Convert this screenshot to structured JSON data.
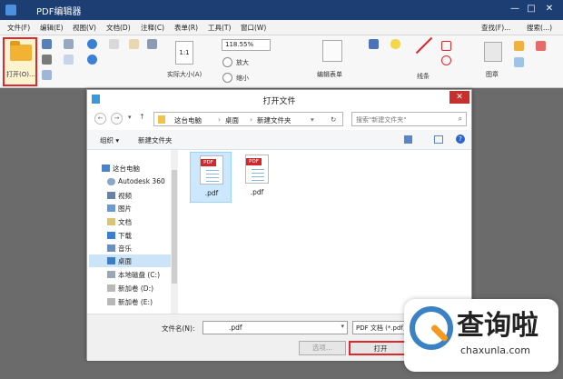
{
  "app": {
    "title": "PDF编辑器",
    "window_controls": [
      "—",
      "□",
      "✕"
    ]
  },
  "menu": [
    "文件(F)",
    "编辑(E)",
    "视图(V)",
    "文档(D)",
    "注释(C)",
    "表单(R)",
    "工具(T)",
    "窗口(W)"
  ],
  "menu_right": {
    "find": "查找(F)...",
    "search": "搜索(...)"
  },
  "ribbon": {
    "open_label": "打开(O)...",
    "actual_size": "实际大小(A)",
    "zoom_value": "118.55%",
    "zoom_in": "放大",
    "zoom_out": "缩小",
    "edit_form": "编辑表单",
    "line": "线条",
    "chapter": "图章"
  },
  "dialog": {
    "title": "打开文件",
    "close": "✕",
    "path": [
      "这台电脑",
      "桌面",
      "新建文件夹"
    ],
    "search_placeholder": "搜索\"新建文件夹\"",
    "organize": "组织 ▾",
    "new_folder": "新建文件夹",
    "nav": [
      "这台电脑",
      "Autodesk 360",
      "视频",
      "图片",
      "文档",
      "下载",
      "音乐",
      "桌面",
      "本地磁盘 (C:)",
      "新加卷 (D:)",
      "新加卷 (E:)"
    ],
    "files": [
      {
        "tag": "PDF",
        "name": ".pdf"
      },
      {
        "tag": "PDF",
        "name": ".pdf"
      }
    ],
    "filename_label": "文件名(N):",
    "filename_value": ".pdf",
    "filetype": "PDF 文档 (*.pdf)",
    "options": "选项...",
    "open": "打开"
  },
  "watermark": {
    "title": "查询啦",
    "url": "chaxunla.com"
  },
  "colors": {
    "titlebar": "#1d3e73",
    "highlight": "#e0272e",
    "workspace": "#6b6b6b"
  }
}
